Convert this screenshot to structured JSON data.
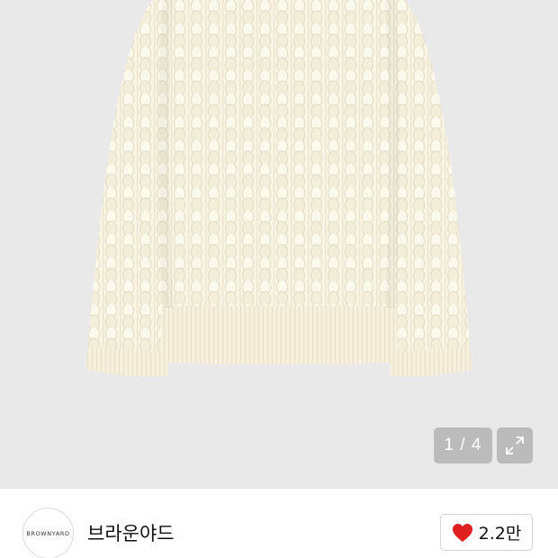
{
  "gallery": {
    "counter": "1 / 4",
    "expand_icon": "expand-icon"
  },
  "seller": {
    "avatar_text": "BROWNYARD",
    "name": "브라운야드"
  },
  "like": {
    "icon": "heart-icon",
    "count": "2.2만"
  },
  "colors": {
    "gallery_bg": "#e9e9ea",
    "sweater": "#f8f3e2",
    "heart": "#e02020"
  }
}
